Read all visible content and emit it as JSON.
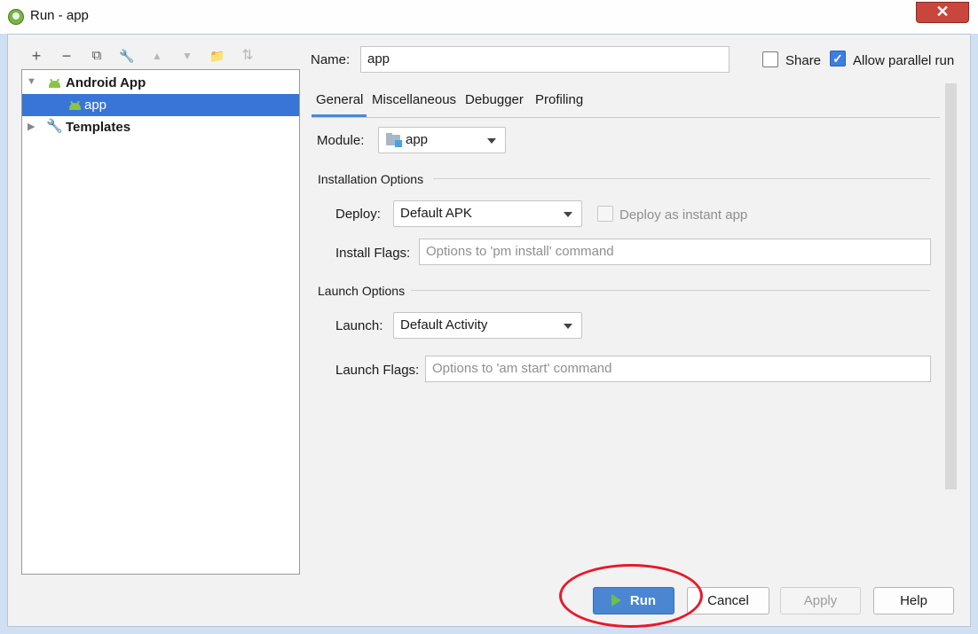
{
  "window": {
    "title": "Run - app",
    "close_glyph": "✕"
  },
  "toolbar": {
    "icons": [
      {
        "name": "add-icon",
        "glyph": "+"
      },
      {
        "name": "remove-icon",
        "glyph": "−"
      },
      {
        "name": "copy-icon",
        "glyph": "⧉"
      },
      {
        "name": "wrench-icon",
        "glyph": "🔧"
      },
      {
        "name": "move-up-icon",
        "glyph": "▲"
      },
      {
        "name": "move-down-icon",
        "glyph": "▼"
      },
      {
        "name": "new-folder-icon",
        "glyph": "📁"
      },
      {
        "name": "sort-icon",
        "glyph": "⇅"
      }
    ]
  },
  "tree": {
    "group1": {
      "label": "Android App",
      "arrow": "▼"
    },
    "item1": {
      "label": "app"
    },
    "group2": {
      "label": "Templates",
      "arrow": "▶"
    }
  },
  "header": {
    "name_label": "Name:",
    "name_value": "app",
    "share_label": "Share",
    "share_checked": false,
    "parallel_label": "Allow parallel run",
    "parallel_checked": true,
    "check_glyph": "✓"
  },
  "tabs": [
    {
      "label": "General",
      "active": true
    },
    {
      "label": "Miscellaneous",
      "active": false
    },
    {
      "label": "Debugger",
      "active": false
    },
    {
      "label": "Profiling",
      "active": false
    }
  ],
  "general": {
    "module_label": "Module:",
    "module_value": "app",
    "installation_header": "Installation Options",
    "deploy_label": "Deploy:",
    "deploy_value": "Default APK",
    "instant_label": "Deploy as instant app",
    "install_flags_label": "Install Flags:",
    "install_flags_placeholder": "Options to 'pm install' command",
    "launch_header": "Launch Options",
    "launch_label": "Launch:",
    "launch_value": "Default Activity",
    "launch_flags_label": "Launch Flags:",
    "launch_flags_placeholder": "Options to 'am start' command"
  },
  "buttons": {
    "run": "Run",
    "cancel": "Cancel",
    "apply": "Apply",
    "help": "Help"
  },
  "colors": {
    "selection": "#3875d7",
    "primary_button": "#4a86d2",
    "highlight_ring": "#e8182b",
    "android_green": "#8bc34a"
  }
}
